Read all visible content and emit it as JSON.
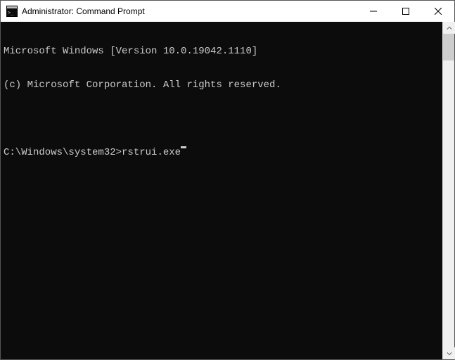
{
  "window": {
    "title": "Administrator: Command Prompt"
  },
  "terminal": {
    "line1": "Microsoft Windows [Version 10.0.19042.1110]",
    "line2": "(c) Microsoft Corporation. All rights reserved.",
    "blank": "",
    "prompt": "C:\\Windows\\system32>",
    "command": "rstrui.exe"
  },
  "colors": {
    "terminal_bg": "#0c0c0c",
    "terminal_fg": "#cccccc"
  }
}
